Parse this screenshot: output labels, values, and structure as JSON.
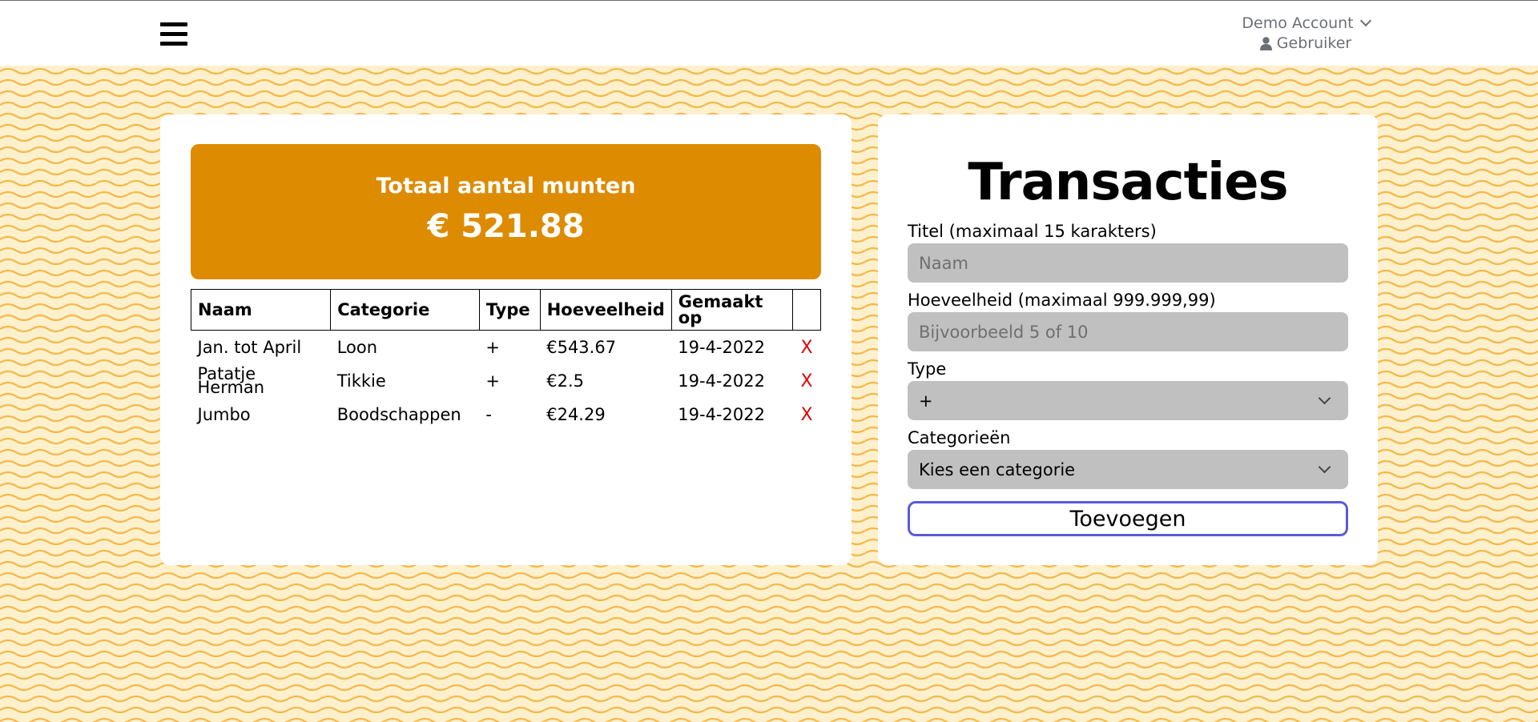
{
  "header": {
    "account_name": "Demo Account",
    "user_label": "Gebruiker"
  },
  "balance": {
    "label": "Totaal aantal munten",
    "value": "€ 521.88"
  },
  "table": {
    "columns": [
      "Naam",
      "Categorie",
      "Type",
      "Hoeveelheid",
      "Gemaakt op"
    ],
    "rows": [
      {
        "naam": "Jan. tot April",
        "categorie": "Loon",
        "type": "+",
        "hoeveelheid": "€543.67",
        "datum": "19-4-2022",
        "delete": "X"
      },
      {
        "naam": "Patatje Herman",
        "categorie": "Tikkie",
        "type": "+",
        "hoeveelheid": "€2.5",
        "datum": "19-4-2022",
        "delete": "X"
      },
      {
        "naam": "Jumbo",
        "categorie": "Boodschappen",
        "type": "-",
        "hoeveelheid": "€24.29",
        "datum": "19-4-2022",
        "delete": "X"
      }
    ]
  },
  "form": {
    "title": "Transacties",
    "titel_label": "Titel (maximaal 15 karakters)",
    "titel_placeholder": "Naam",
    "hoeveelheid_label": "Hoeveelheid (maximaal 999.999,99)",
    "hoeveelheid_placeholder": "Bijvoorbeeld 5 of 10",
    "type_label": "Type",
    "type_value": "+",
    "categorie_label": "Categorieën",
    "categorie_value": "Kies een categorie",
    "submit_label": "Toevoegen"
  },
  "colors": {
    "accent": "#dd8b00",
    "background": "#fdf0cc",
    "wave": "#f4b84a",
    "delete": "#e00000",
    "button_border": "#5b5bd9"
  }
}
